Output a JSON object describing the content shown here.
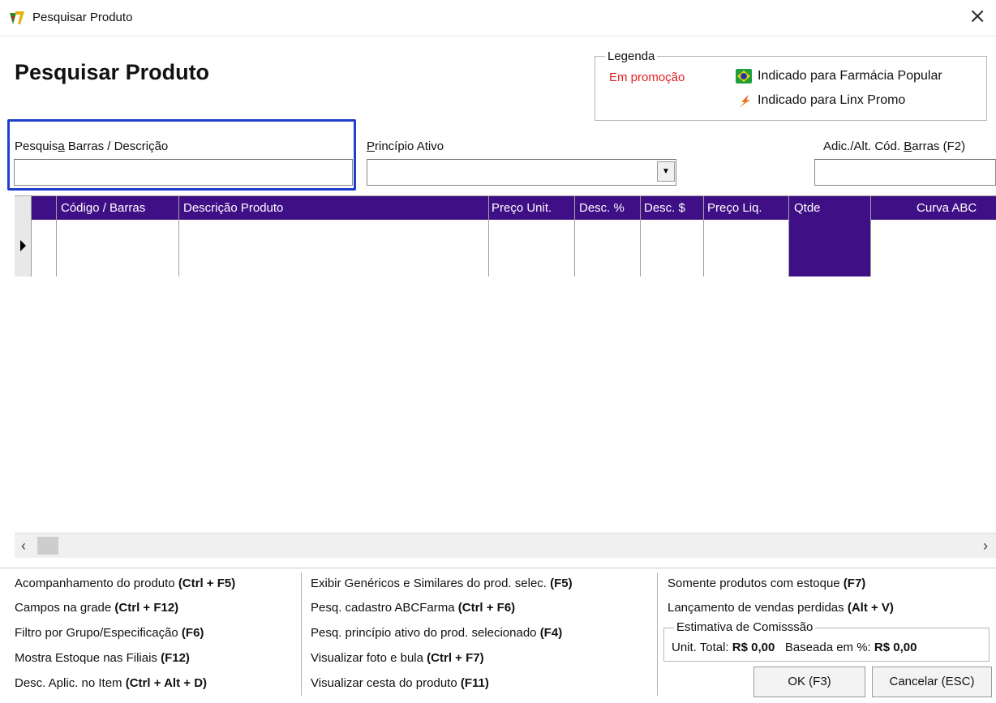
{
  "window": {
    "title": "Pesquisar Produto",
    "close_glyph": "×"
  },
  "page_title": "Pesquisar Produto",
  "legend": {
    "caption": "Legenda",
    "promo_label": "Em promoção",
    "promo_color": "#e02020",
    "popular_label": "Indicado para Farmácia Popular",
    "popular_icon": "brazil-flag-icon",
    "linx_label": "Indicado para Linx Promo",
    "linx_icon": "lightning-icon"
  },
  "search": {
    "label_pre": "Pesquis",
    "label_accel": "a",
    "label_post": " Barras / Descrição",
    "value": ""
  },
  "principio": {
    "label_accel": "P",
    "label_post": "rincípio Ativo",
    "value": ""
  },
  "barras": {
    "label_pre": "Adic./Alt. Cód. ",
    "label_accel": "B",
    "label_post": "arras (F2)",
    "value": ""
  },
  "grid": {
    "header_color": "#3f0f86",
    "columns": [
      "Código / Barras",
      "Descrição Produto",
      "Preço Unit.",
      "Desc. %",
      "Desc. $",
      "Preço Liq.",
      "Qtde",
      "Curva ABC"
    ],
    "rows": []
  },
  "shortcuts": {
    "col1": [
      {
        "text": "Acompanhamento do produto ",
        "key": "(Ctrl + F5)"
      },
      {
        "text": "Campos na grade ",
        "key": "(Ctrl + F12)"
      },
      {
        "text": "Filtro por Grupo/Especificação ",
        "key": "(F6)"
      },
      {
        "text": "Mostra Estoque nas Filiais ",
        "key": "(F12)"
      },
      {
        "text": "Desc. Aplic. no Item ",
        "key": "(Ctrl + Alt + D)"
      }
    ],
    "col2": [
      {
        "text": "Exibir Genéricos e Similares do prod. selec. ",
        "key": "(F5)"
      },
      {
        "text": "Pesq. cadastro ABCFarma ",
        "key": "(Ctrl + F6)"
      },
      {
        "text": "Pesq. princípio ativo do prod. selecionado ",
        "key": "(F4)"
      },
      {
        "text": "Visualizar foto e bula ",
        "key": "(Ctrl + F7)"
      },
      {
        "text": "Visualizar cesta do produto ",
        "key": "(F11)"
      }
    ],
    "col3": [
      {
        "text": "Somente produtos com estoque ",
        "key": "(F7)"
      },
      {
        "text": "Lançamento de vendas perdidas ",
        "key": "(Alt + V)"
      }
    ]
  },
  "estimativa": {
    "caption": "Estimativa de Comisssão",
    "unit_label": "Unit. Total: ",
    "unit_value": "R$ 0,00",
    "base_label": "Baseada em %: ",
    "base_value": "R$ 0,00"
  },
  "buttons": {
    "ok": "OK (F3)",
    "cancel": "Cancelar (ESC)"
  }
}
